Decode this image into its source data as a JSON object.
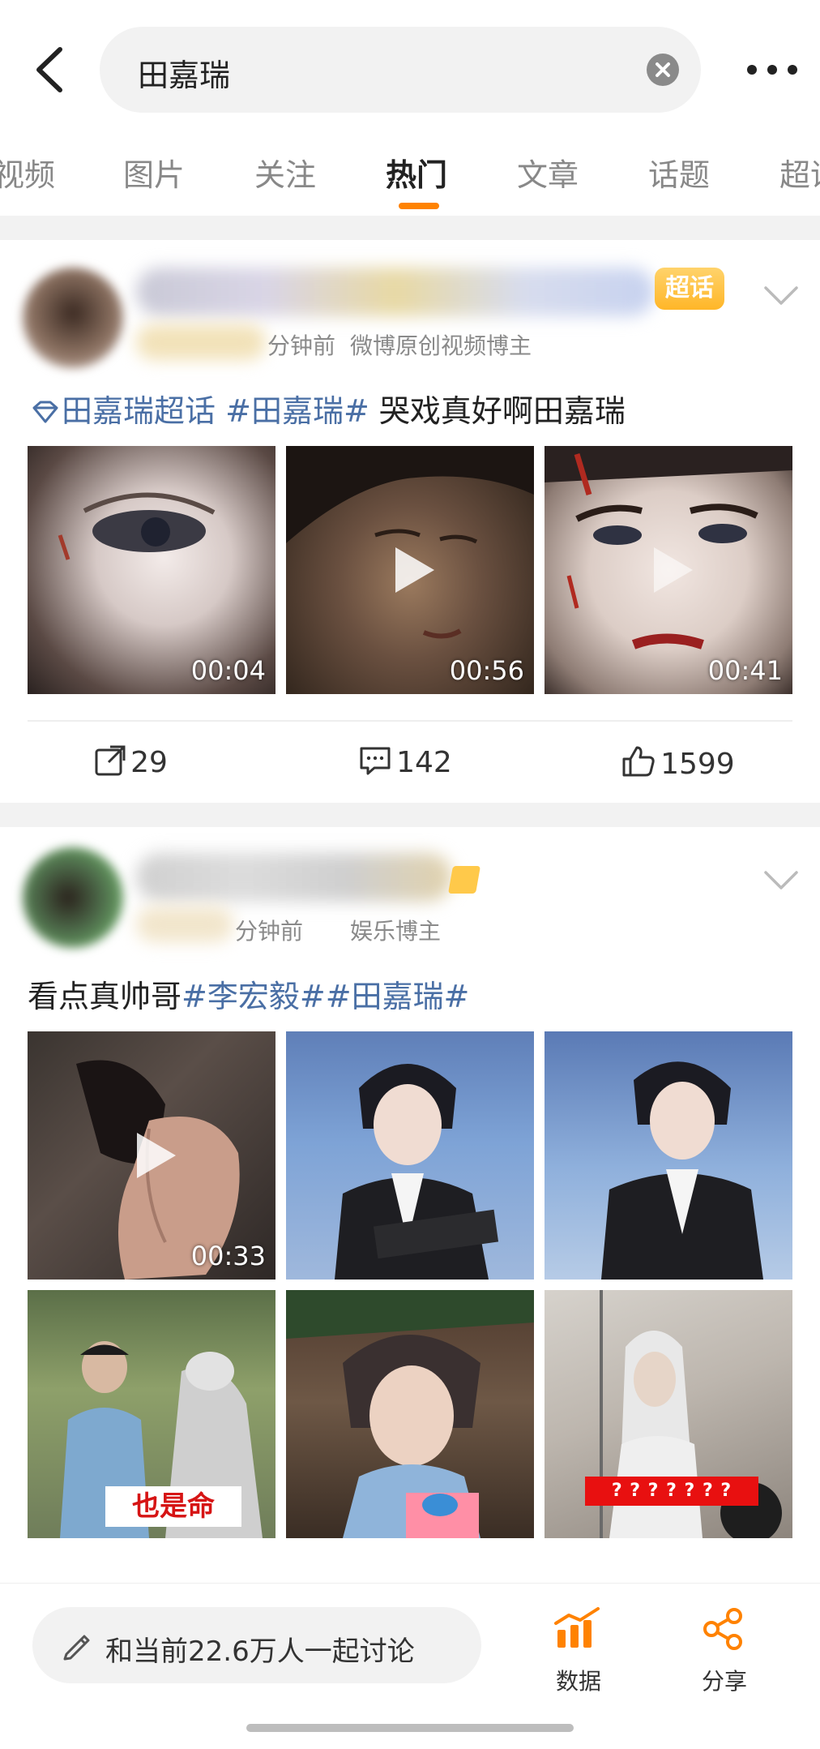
{
  "search": {
    "query": "田嘉瑞"
  },
  "tabs": [
    "视频",
    "图片",
    "关注",
    "热门",
    "文章",
    "话题",
    "超话"
  ],
  "posts": [
    {
      "time": "分钟前",
      "source": "微博原创视频博主",
      "badge": "超话",
      "topic_link": "田嘉瑞超话",
      "tag": "#田嘉瑞#",
      "text": " 哭戏真好啊田嘉瑞",
      "durations": [
        "00:04",
        "00:56",
        "00:41"
      ],
      "reposts": "29",
      "comments": "142",
      "likes": "1599"
    },
    {
      "time": "分钟前",
      "source": "娱乐博主",
      "text_prefix": "看点真帅哥",
      "tags": "#李宏毅##田嘉瑞#",
      "durations": [
        "00:33"
      ],
      "captions": [
        "也是命",
        "? ? ? ? ? ? ?"
      ]
    }
  ],
  "bottom": {
    "discuss": "和当前22.6万人一起讨论",
    "data_label": "数据",
    "share_label": "分享"
  },
  "colors": {
    "accent": "#ff8200",
    "tag": "#4a6fa5",
    "background_gap": "#f2f2f2"
  }
}
